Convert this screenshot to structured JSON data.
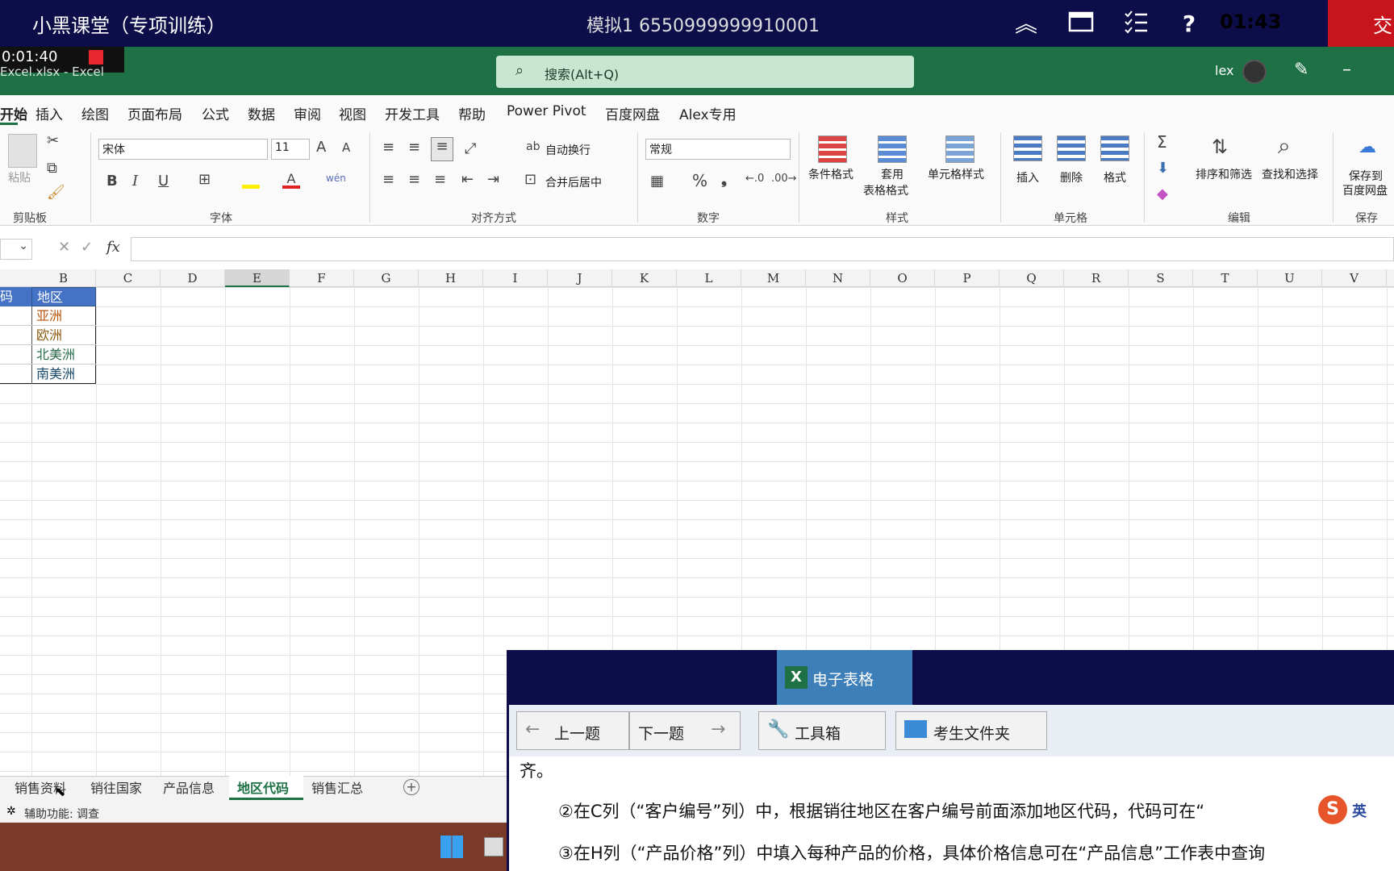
{
  "exam_bar": {
    "title": "小黑课堂（专项训练）",
    "exam_id": "模拟1  6550999999910001",
    "time": "01:43",
    "submit": "交",
    "help": "?"
  },
  "excel": {
    "recording_time": "0:01:40",
    "file_name": "Excel.xlsx  -  Excel",
    "search_placeholder": "搜索(Alt+Q)",
    "user": "lex"
  },
  "menu": [
    "开始",
    "插入",
    "绘图",
    "页面布局",
    "公式",
    "数据",
    "审阅",
    "视图",
    "开发工具",
    "帮助",
    "Power Pivot",
    "百度网盘",
    "Alex专用"
  ],
  "ribbon": {
    "clipboard": {
      "label": "剪贴板",
      "paste": "粘贴"
    },
    "font": {
      "label": "字体",
      "name": "宋体",
      "size": "11",
      "bold": "B",
      "italic": "I",
      "underline": "U",
      "grow": "A",
      "shrink": "A"
    },
    "align": {
      "label": "对齐方式",
      "wrap": "自动换行",
      "merge": "合并后居中"
    },
    "number": {
      "label": "数字",
      "format": "常规",
      "percent": "%",
      "comma": "❟"
    },
    "styles": {
      "label": "样式",
      "cond": "条件格式",
      "table_1": "套用",
      "table_2": "表格格式",
      "cell": "单元格样式"
    },
    "cells": {
      "label": "单元格",
      "insert": "插入",
      "delete": "删除",
      "format": "格式"
    },
    "edit": {
      "label": "编辑",
      "sort": "排序和筛选",
      "find": "查找和选择"
    },
    "save": {
      "label": "保存",
      "btn_1": "保存到",
      "btn_2": "百度网盘"
    }
  },
  "formula_bar": {
    "fx": "fx",
    "value": ""
  },
  "columns": [
    "B",
    "C",
    "D",
    "E",
    "F",
    "G",
    "H",
    "I",
    "J",
    "K",
    "L",
    "M",
    "N",
    "O",
    "P",
    "Q",
    "R",
    "S",
    "T",
    "U",
    "V"
  ],
  "table": {
    "header_a": "码",
    "header_b": "地区",
    "rows": [
      "亚洲",
      "欧洲",
      "北美洲",
      "南美洲"
    ]
  },
  "sheets": [
    "销售资料",
    "销往国家",
    "产品信息",
    "地区代码",
    "销售汇总"
  ],
  "active_sheet": "地区代码",
  "status": "辅助功能: 调查",
  "panel": {
    "tab": "电子表格",
    "prev": "上一题",
    "next": "下一题",
    "toolbox": "工具箱",
    "folder": "考生文件夹",
    "line0": "齐。",
    "line1": "②在C列（“客户编号”列）中，根据销往地区在客户编号前面添加地区代码，代码可在“",
    "line2": "③在H列（“产品价格”列）中填入每种产品的价格，具体价格信息可在“产品信息”工作表中查询",
    "ime": "英"
  }
}
